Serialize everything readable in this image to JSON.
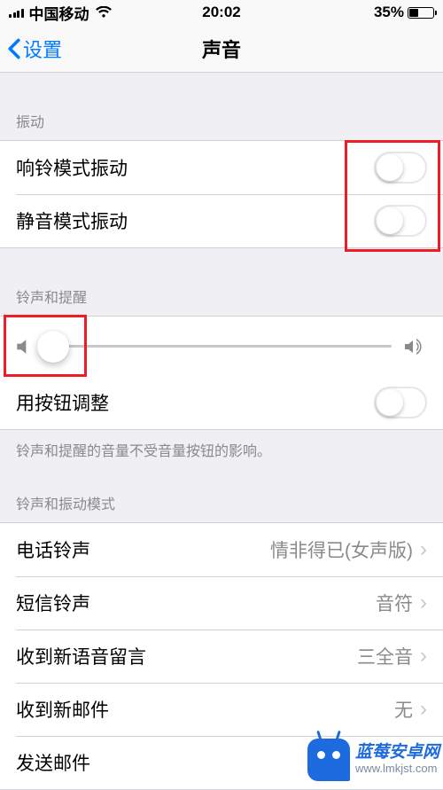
{
  "status": {
    "carrier": "中国移动",
    "time": "20:02",
    "battery_pct": "35%"
  },
  "nav": {
    "back": "设置",
    "title": "声音"
  },
  "sections": {
    "vibration_header": "振动",
    "ring_vibrate": "响铃模式振动",
    "silent_vibrate": "静音模式振动",
    "ringer_header": "铃声和提醒",
    "buttons_adjust": "用按钮调整",
    "ringer_footer": "铃声和提醒的音量不受音量按钮的影响。",
    "pattern_header": "铃声和振动模式",
    "ringtone_label": "电话铃声",
    "ringtone_value": "情非得已(女声版)",
    "text_label": "短信铃声",
    "text_value": "音符",
    "voicemail_label": "收到新语音留言",
    "voicemail_value": "三全音",
    "mail_label": "收到新邮件",
    "mail_value": "无",
    "sent_mail_label": "发送邮件"
  },
  "watermark": {
    "title": "蓝莓安卓网",
    "url": "www.lmkjst.com"
  }
}
